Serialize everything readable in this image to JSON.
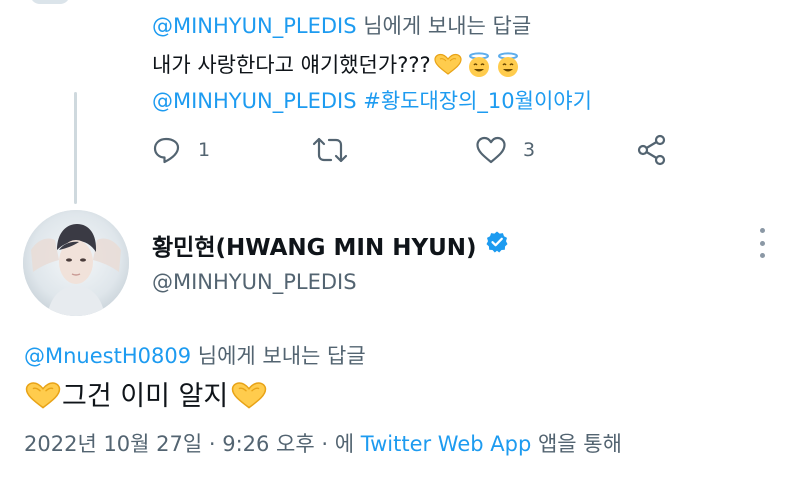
{
  "previous_tweet": {
    "reply_to_handle": "@MINHYUN_PLEDIS",
    "reply_to_suffix": "님에게 보내는 답글",
    "text": "내가 사랑한다고 얘기했던가???",
    "mention": "@MINHYUN_PLEDIS",
    "hashtag": "#황도대장의_10월이야기",
    "actions": {
      "reply_count": "1",
      "like_count": "3"
    }
  },
  "main_tweet": {
    "display_name": "황민현(HWANG MIN HYUN)",
    "screen_name": "@MINHYUN_PLEDIS",
    "reply_to_handle": "@MnuestH0809",
    "reply_to_suffix": "님에게 보내는 답글",
    "text": "그건 이미 알지",
    "timestamp": "2022년 10월 27일 · 9:26 오후 · 에",
    "source": "Twitter Web App",
    "source_suffix": "앱을 통해"
  },
  "icons": [
    "reply-icon",
    "retweet-icon",
    "like-icon",
    "share-icon",
    "verified-badge-icon",
    "more-options-icon",
    "heart-hands-emoji",
    "angel-emoji"
  ],
  "colors": {
    "link": "#1d9bf0",
    "secondary_text": "#536471",
    "primary_text": "#0f1419",
    "thread_line": "#cfd9de",
    "heart_hands": "#ffcc4d"
  }
}
